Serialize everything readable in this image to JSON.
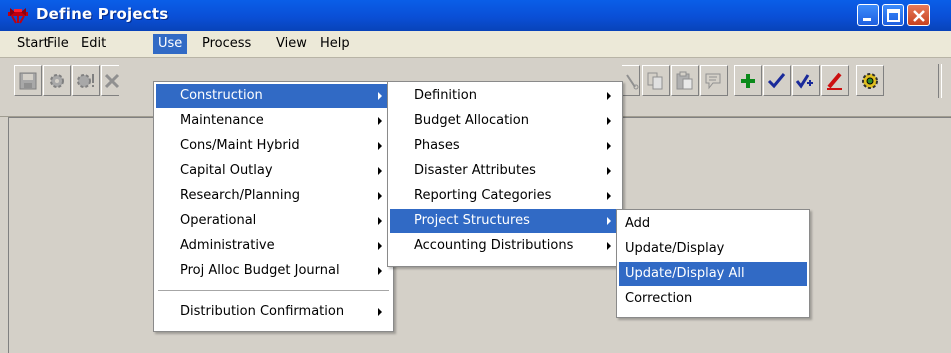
{
  "window": {
    "title": "Define Projects"
  },
  "menubar": {
    "items": [
      "Start",
      "File",
      "Edit",
      "Use",
      "Process",
      "View",
      "Help"
    ],
    "active": "Use"
  },
  "toolbar": {
    "icons": [
      "save-icon",
      "gear-icon",
      "gear-alert-icon",
      "delete-icon",
      "cut-icon",
      "copy-icon",
      "paste-icon",
      "note-icon",
      "add-icon",
      "check-icon",
      "check-all-icon",
      "edit-icon",
      "settings-icon"
    ]
  },
  "use_menu": {
    "items": [
      {
        "label": "Construction",
        "submenu": true,
        "highlighted": true
      },
      {
        "label": "Maintenance",
        "submenu": true
      },
      {
        "label": "Cons/Maint Hybrid",
        "submenu": true
      },
      {
        "label": "Capital Outlay",
        "submenu": true
      },
      {
        "label": "Research/Planning",
        "submenu": true
      },
      {
        "label": "Operational",
        "submenu": true
      },
      {
        "label": "Administrative",
        "submenu": true
      },
      {
        "label": "Proj Alloc Budget Journal",
        "submenu": true
      },
      {
        "label": "Distribution Confirmation",
        "submenu": true
      }
    ]
  },
  "construction_menu": {
    "items": [
      {
        "label": "Definition",
        "submenu": true
      },
      {
        "label": "Budget Allocation",
        "submenu": true
      },
      {
        "label": "Phases",
        "submenu": true
      },
      {
        "label": "Disaster Attributes",
        "submenu": true
      },
      {
        "label": "Reporting Categories",
        "submenu": true
      },
      {
        "label": "Project Structures",
        "submenu": true,
        "highlighted": true
      },
      {
        "label": "Accounting Distributions",
        "submenu": true
      }
    ]
  },
  "project_structures_menu": {
    "items": [
      {
        "label": "Add"
      },
      {
        "label": "Update/Display"
      },
      {
        "label": "Update/Display All",
        "highlighted": true
      },
      {
        "label": "Correction"
      }
    ]
  },
  "colors": {
    "titlebar": "#0a4fd6",
    "highlight": "#316ac5",
    "face": "#d4d0c8",
    "menubar": "#ece9d8"
  }
}
